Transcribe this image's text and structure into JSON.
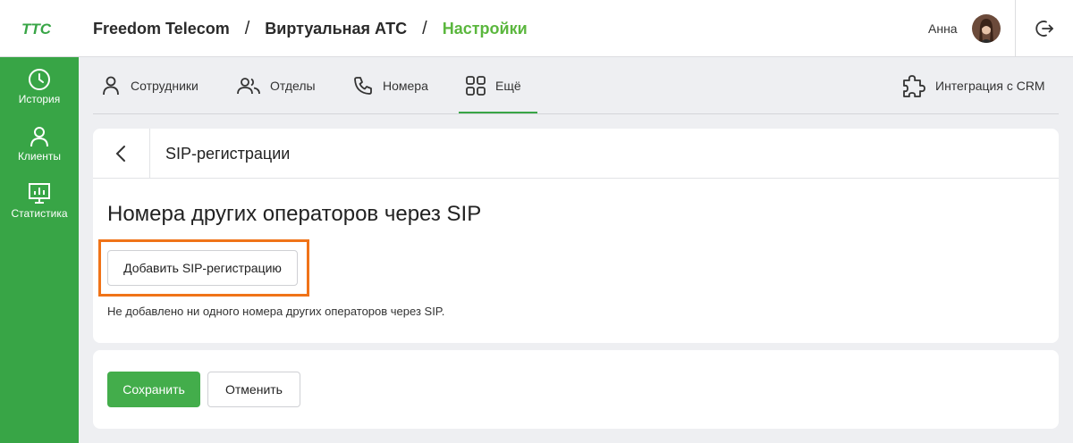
{
  "header": {
    "logo_text": "ТТС",
    "breadcrumb": [
      "Freedom Telecom",
      "Виртуальная АТС",
      "Настройки"
    ],
    "separator": "/",
    "user_name": "Анна"
  },
  "sidebar": {
    "items": [
      {
        "label": "История",
        "icon": "clock-icon"
      },
      {
        "label": "Клиенты",
        "icon": "person-icon"
      },
      {
        "label": "Статистика",
        "icon": "chart-monitor-icon"
      }
    ]
  },
  "tabs": {
    "items": [
      {
        "label": "Сотрудники",
        "icon": "person-icon"
      },
      {
        "label": "Отделы",
        "icon": "people-icon"
      },
      {
        "label": "Номера",
        "icon": "phone-icon"
      },
      {
        "label": "Ещё",
        "icon": "grid-icon",
        "active": true
      }
    ],
    "integration": {
      "label": "Интеграция с CRM",
      "icon": "puzzle-icon"
    }
  },
  "sip_card": {
    "title": "SIP-регистрации",
    "heading": "Номера других операторов через SIP",
    "add_button": "Добавить SIP-регистрацию",
    "empty_text": "Не добавлено ни одного номера других операторов через SIP."
  },
  "actions": {
    "save": "Сохранить",
    "cancel": "Отменить"
  },
  "colors": {
    "accent_green": "#38a546",
    "breadcrumb_active": "#5bb73e",
    "highlight_orange": "#f07318"
  }
}
